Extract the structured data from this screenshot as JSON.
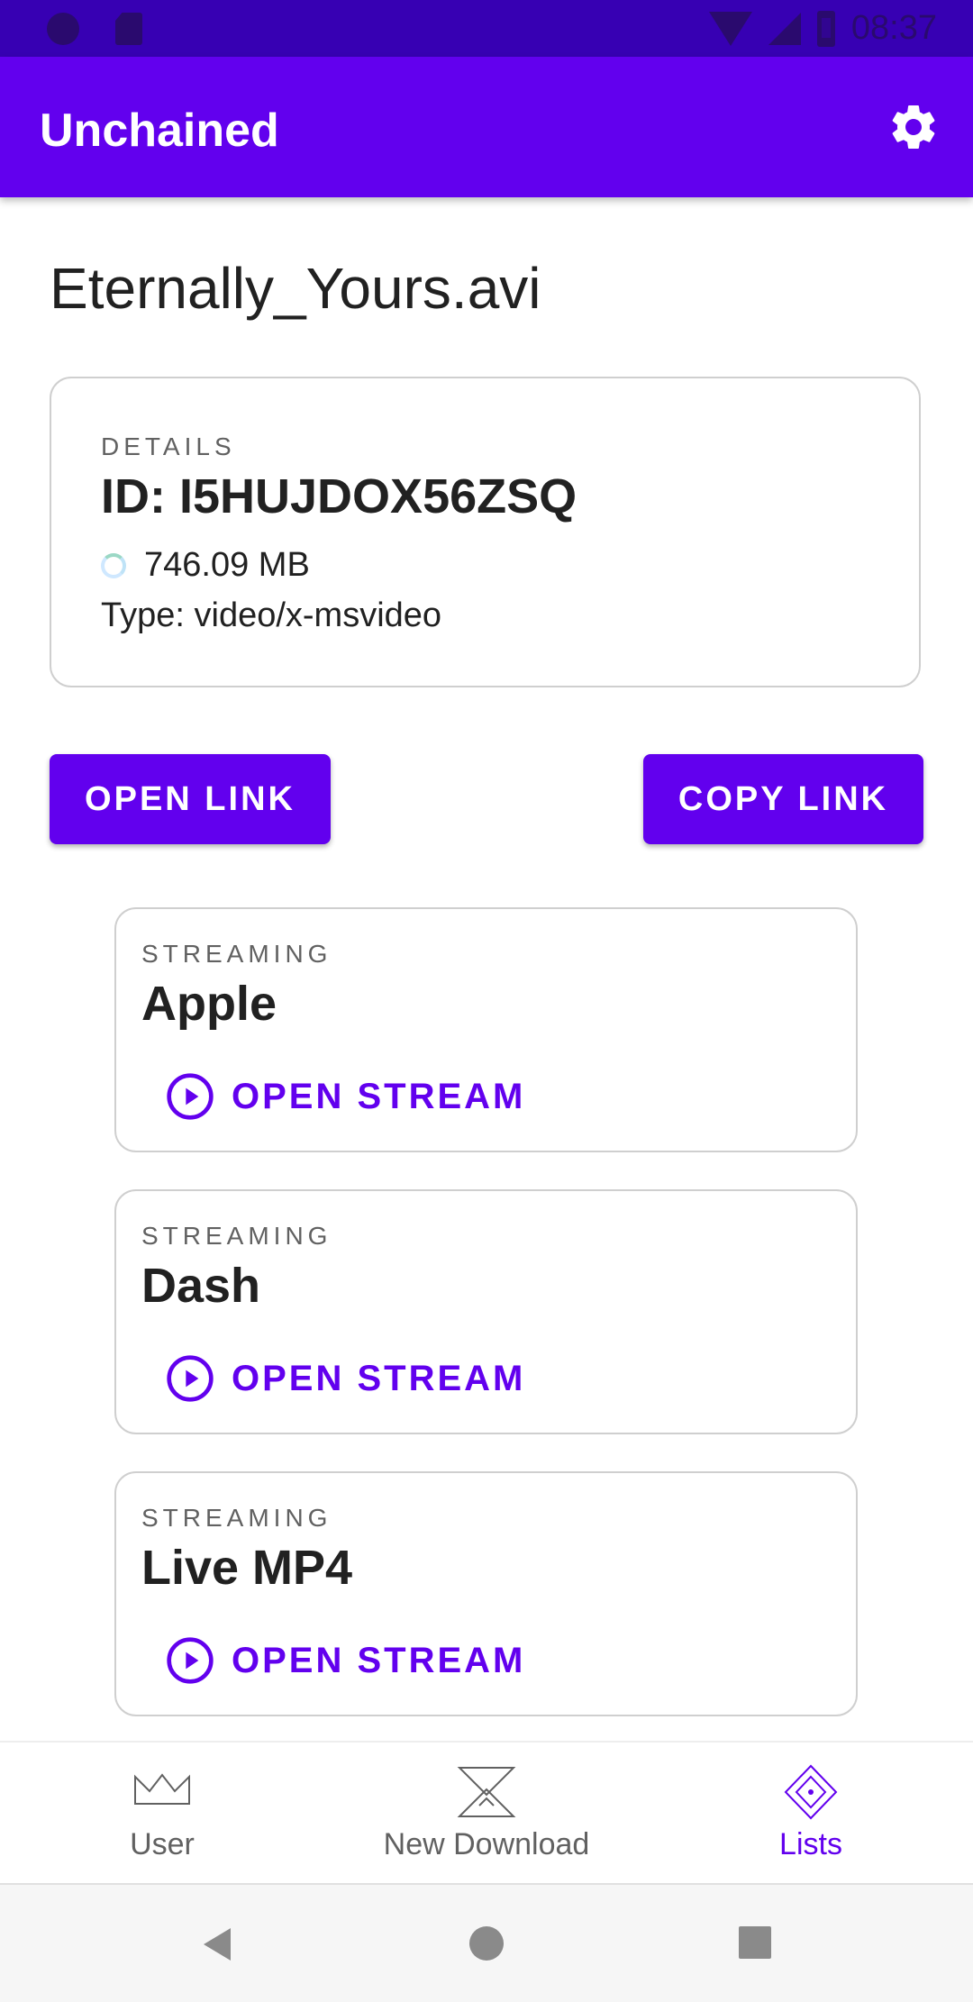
{
  "status_bar": {
    "time": "08:37"
  },
  "app_bar": {
    "title": "Unchained"
  },
  "file": {
    "name": "Eternally_Yours.avi"
  },
  "details": {
    "overline": "DETAILS",
    "id": "ID: I5HUJDOX56ZSQ",
    "size": "746.09 MB",
    "type": "Type: video/x-msvideo"
  },
  "actions": {
    "open_link": "OPEN LINK",
    "copy_link": "COPY LINK"
  },
  "streams": [
    {
      "overline": "STREAMING",
      "name": "Apple",
      "action": "OPEN STREAM"
    },
    {
      "overline": "STREAMING",
      "name": "Dash",
      "action": "OPEN STREAM"
    },
    {
      "overline": "STREAMING",
      "name": "Live MP4",
      "action": "OPEN STREAM"
    }
  ],
  "bottom_nav": {
    "items": [
      {
        "label": "User",
        "icon": "crown-icon",
        "active": false
      },
      {
        "label": "New Download",
        "icon": "hourglass-icon",
        "active": false
      },
      {
        "label": "Lists",
        "icon": "diamond-icon",
        "active": true
      }
    ]
  },
  "colors": {
    "primary": "#6200EE",
    "primary_dark": "#3700B3"
  }
}
